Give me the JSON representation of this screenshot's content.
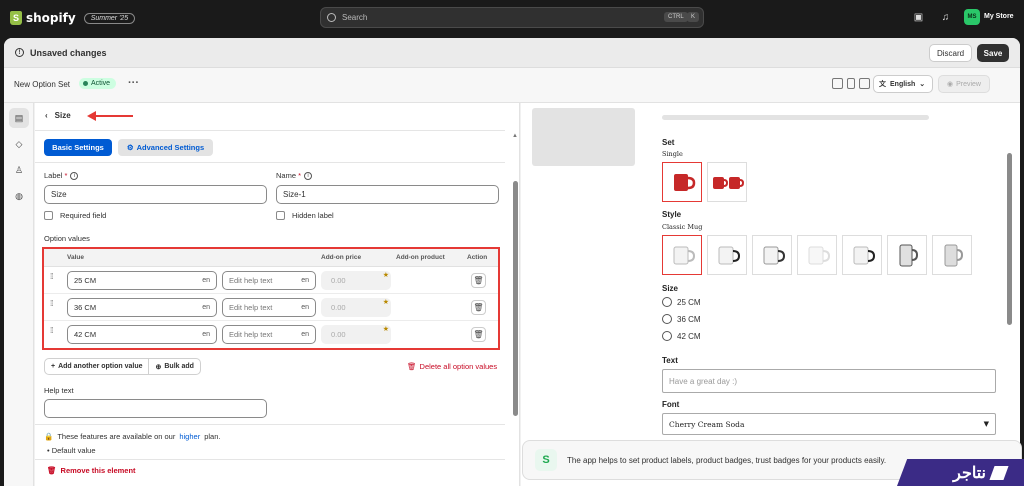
{
  "topbar": {
    "brand": "shopify",
    "edition": "Summer '25",
    "search_placeholder": "Search",
    "kbd_1": "CTRL",
    "kbd_2": "K",
    "avatar_initials": "MS",
    "store_name": "My Store"
  },
  "savebar": {
    "message": "Unsaved changes",
    "discard": "Discard",
    "save": "Save"
  },
  "option_set": {
    "title": "New Option Set",
    "status": "Active",
    "language": "English",
    "preview": "Preview"
  },
  "editor": {
    "back_label": "Size",
    "tab_basic": "Basic Settings",
    "tab_advanced": "Advanced Settings",
    "label_field_label": "Label",
    "label_value": "Size",
    "name_field_label": "Name",
    "name_value": "Size-1",
    "required_field": "Required field",
    "hidden_label": "Hidden label",
    "option_values_heading": "Option values",
    "columns": [
      "Value",
      "Add-on price",
      "Add-on product",
      "Action"
    ],
    "rows": [
      {
        "value": "25 CM",
        "lang": "en",
        "help_placeholder": "Edit help text",
        "help_lang": "en",
        "price": "0.00"
      },
      {
        "value": "36 CM",
        "lang": "en",
        "help_placeholder": "Edit help text",
        "help_lang": "en",
        "price": "0.00"
      },
      {
        "value": "42 CM",
        "lang": "en",
        "help_placeholder": "Edit help text",
        "help_lang": "en",
        "price": "0.00"
      }
    ],
    "add_option": "Add another option value",
    "bulk_add": "Bulk add",
    "delete_all": "Delete all option values",
    "help_text_label": "Help text",
    "features_text": "These features are available on our",
    "features_link": "higher",
    "features_suffix": "plan.",
    "default_value": "Default value",
    "remove_element": "Remove this element"
  },
  "preview_panel": {
    "set_label": "Set",
    "set_value": "Single",
    "style_label": "Style",
    "style_value": "Classic Mug",
    "size_label": "Size",
    "sizes": [
      "25 CM",
      "36 CM",
      "42 CM"
    ],
    "text_label": "Text",
    "text_placeholder": "Have a great day :)",
    "font_label": "Font",
    "font_value": "Cherry Cream Soda",
    "banner_text": "The app helps to set product labels, product badges, trust badges for your products easily."
  },
  "watermark": "نتاجر",
  "colors": {
    "accent": "#005bd3",
    "danger": "#c70a24",
    "active_badge": "#cdfee1",
    "highlight": "#e53935"
  }
}
